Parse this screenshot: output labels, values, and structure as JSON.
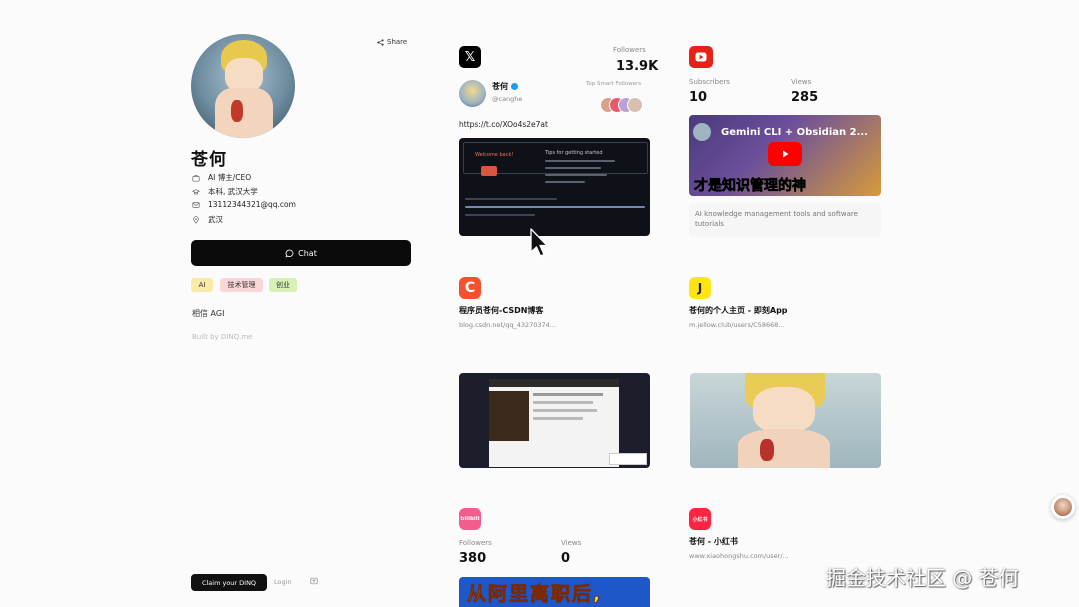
{
  "profile": {
    "share_label": "Share",
    "name": "苍何",
    "info": [
      {
        "icon": "briefcase-icon",
        "text": "AI 博主/CEO"
      },
      {
        "icon": "graduation-cap-icon",
        "text": "本科, 武汉大学"
      },
      {
        "icon": "mail-icon",
        "text": "13112344321@qq.com"
      },
      {
        "icon": "location-pin-icon",
        "text": "武汉"
      }
    ],
    "chat_label": "Chat",
    "tags": [
      {
        "label": "AI",
        "color": "#fbe9a8"
      },
      {
        "label": "技术管理",
        "color": "#fbd6d9"
      },
      {
        "label": "创业",
        "color": "#d7f0b6"
      }
    ],
    "motto": "相信 AGI",
    "built_with": "Built by DINQ.me",
    "claim_label": "Claim your DINQ",
    "login_label": "Login"
  },
  "twitter": {
    "followers_label": "Followers",
    "followers": "13.9K",
    "display_name": "苍何",
    "handle": "@canghe",
    "top_smart_label": "Top Smart Followers",
    "link": "https://t.co/XOo4s2e7at",
    "terminal": {
      "header_left": "Welcome back!",
      "header_right": "Tips for getting started"
    }
  },
  "youtube": {
    "subscribers_label": "Subscribers",
    "subscribers": "10",
    "views_label": "Views",
    "views": "285",
    "thumb_top": "Gemini CLI + Obsidian 2...",
    "thumb_bottom": "才是知识管理的神",
    "description": "AI knowledge management tools and software tutorials"
  },
  "csdn": {
    "title": "程序员苍何-CSDN博客",
    "url": "blog.csdn.net/qq_43270374..."
  },
  "jike": {
    "title": "苍何的个人主页 - 即刻App",
    "url": "m.jellow.club/users/C58668..."
  },
  "bilibili": {
    "logo_text": "bilibili",
    "followers_label": "Followers",
    "followers": "380",
    "views_label": "Views",
    "views": "0",
    "banner_text": "从阿里离职后,"
  },
  "xiaohongshu": {
    "logo_text": "小红书",
    "title": "苍何 - 小红书",
    "url": "www.xiaohongshu.com/user/..."
  },
  "watermark": "掘金技术社区 @ 苍何",
  "colors": {
    "x": "#000000",
    "youtube": "#e62117",
    "csdn": "#f4512c",
    "jike": "#ffe411",
    "bilibili": "#f25d8e",
    "xiaohongshu": "#ff2442"
  }
}
